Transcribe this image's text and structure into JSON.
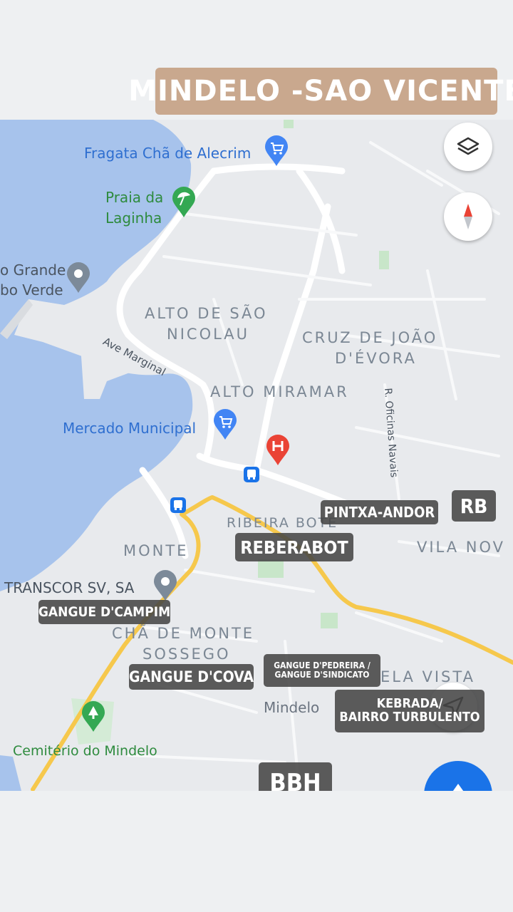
{
  "title": "MINDELO -SAO VICENTE",
  "places": {
    "fragata": "Fragata Chã de Alecrim",
    "praia_line1": "Praia da",
    "praia_line2": "Laginha",
    "porto_line1": "o Grande",
    "porto_line2": "bo Verde",
    "ave_marginal": "Ave Marginal",
    "mercado": "Mercado Municipal",
    "transcor": "TRANSCOR SV, SA",
    "cemiterio": "Cemitério do Mindelo",
    "oficinas": "R. Oficinas Navais",
    "mindelo": "Mindelo"
  },
  "neighborhoods": {
    "alto_sao_line1": "ALTO DE SÃO",
    "alto_sao_line2": "NICOLAU",
    "cruz_line1": "CRUZ DE JOÃO",
    "cruz_line2": "D'ÉVORA",
    "alto_miramar": "ALTO MIRAMAR",
    "ribeira_bote": "RIBEIRA BOTE",
    "monte": "MONTE",
    "vila_nova": "VILA NOV",
    "cha_de_monte": "CHÃ DE MONTE",
    "sossego": "SOSSEGO",
    "bela_vista": "ELA VISTA"
  },
  "tags": {
    "pintxa": "PINTXA-ANDOR",
    "rb": "RB",
    "reberabot": "REBERABOT",
    "campim": "GANGUE D'CAMPIM",
    "cova": "GANGUE D'COVA",
    "pedreira_line1": "GANGUE D'PEDREIRA /",
    "pedreira_line2": "GANGUE D'SINDICATO",
    "kebrada_line1": "KEBRADA/",
    "kebrada_line2": "BAIRRO TURBULENTO",
    "bbh": "BBH"
  },
  "icons": {
    "layers": "layers-icon",
    "compass": "compass-icon",
    "navigate": "navigation-arrow-icon",
    "shopping": "shopping-cart-pin-icon",
    "beach": "beach-pin-icon",
    "hospital": "hospital-pin-icon",
    "bus": "bus-stop-icon",
    "place": "place-pin-icon",
    "park": "tree-pin-icon"
  },
  "colors": {
    "water": "#a7c3ec",
    "land": "#e8eaed",
    "road": "#ffffff",
    "highway": "#f6c84c",
    "banner": "#c9a88e",
    "tag": "#464646",
    "shop_pin": "#4285f4",
    "beach_pin": "#34a853",
    "hospital_pin": "#ea4335",
    "place_pin": "#7c8a99",
    "label_blue": "#2f6fd0",
    "label_green": "#2e8b3e",
    "neighborhood": "#7b8794"
  }
}
